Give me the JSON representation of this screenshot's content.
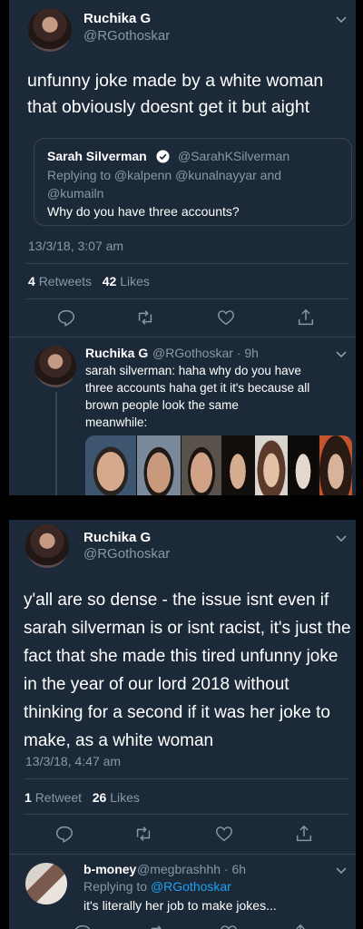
{
  "tweet1": {
    "author": "Ruchika G",
    "handle": "@RGothoskar",
    "text_line1": "unfunny joke made by a white woman",
    "text_line2": "that obviously doesnt get it but aight",
    "quote": {
      "author": "Sarah Silverman",
      "handle": "@SarahKSilverman",
      "replying_line1": "Replying to @kalpenn @kunalnayyar and",
      "replying_line2": "@kumailn",
      "text": "Why do you have three accounts?"
    },
    "timestamp": "13/3/18, 3:07 am",
    "retweets_count": "4",
    "retweets_label": "Retweets",
    "likes_count": "42",
    "likes_label": "Likes"
  },
  "reply1": {
    "author": "Ruchika G",
    "handle_time": "@RGothoskar · 9h",
    "line1": "sarah silverman: haha why do you have",
    "line2": "three accounts haha get it it's because all",
    "line3": "brown people look the same",
    "line4": "meanwhile:"
  },
  "tweet2": {
    "author": "Ruchika G",
    "handle": "@RGothoskar",
    "lines": [
      "y'all are so dense - the issue isnt even if",
      "sarah silverman is or isnt racist, it's just the",
      "fact that she made this tired unfunny joke",
      "in the year of our lord 2018 without",
      "thinking for a second if it was her joke to",
      "make, as a white woman"
    ],
    "timestamp": "13/3/18, 4:47 am",
    "retweets_count": "1",
    "retweets_label": "Retweet",
    "likes_count": "26",
    "likes_label": "Likes"
  },
  "reply2": {
    "author": "b-money",
    "handle_time": "@megbrashhh · 6h",
    "replying_prefix": "Replying to",
    "replying_to": "@RGothoskar",
    "text": "it's literally her job to make jokes..."
  },
  "icons": [
    "reply-icon",
    "retweet-icon",
    "like-icon",
    "share-icon",
    "chevron-down-icon",
    "verified-badge-icon"
  ],
  "colors": {
    "background": "#1c2938",
    "muted": "#8899a6",
    "border": "#38444d",
    "link": "#1da1f2",
    "verified": "#1da1f2"
  }
}
